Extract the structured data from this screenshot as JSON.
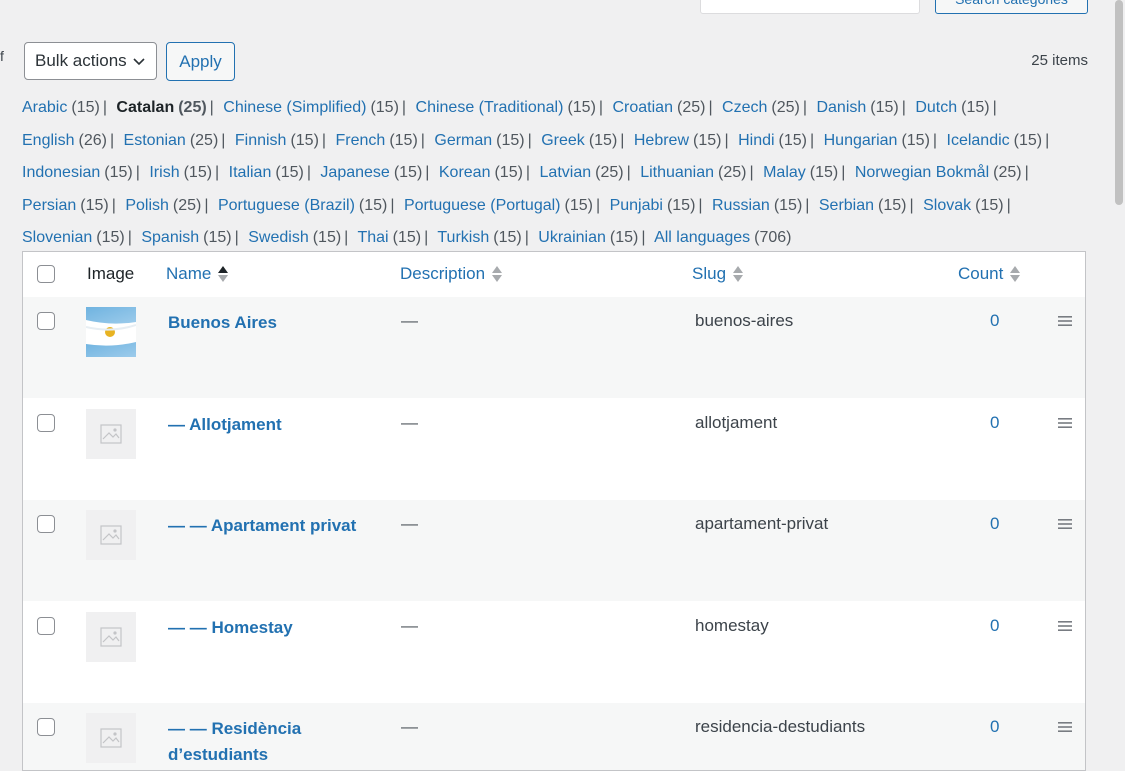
{
  "top": {
    "search_button": "Search categories",
    "truncated_label": "f"
  },
  "bulk": {
    "selected": "Bulk actions",
    "apply": "Apply"
  },
  "items_count": "25 items",
  "languages": [
    {
      "name": "Arabic",
      "count": "(15)",
      "current": false
    },
    {
      "name": "Catalan",
      "count": "(25)",
      "current": true
    },
    {
      "name": "Chinese (Simplified)",
      "count": "(15)",
      "current": false
    },
    {
      "name": "Chinese (Traditional)",
      "count": "(15)",
      "current": false
    },
    {
      "name": "Croatian",
      "count": "(25)",
      "current": false
    },
    {
      "name": "Czech",
      "count": "(25)",
      "current": false
    },
    {
      "name": "Danish",
      "count": "(15)",
      "current": false
    },
    {
      "name": "Dutch",
      "count": "(15)",
      "current": false
    },
    {
      "name": "English",
      "count": "(26)",
      "current": false
    },
    {
      "name": "Estonian",
      "count": "(25)",
      "current": false
    },
    {
      "name": "Finnish",
      "count": "(15)",
      "current": false
    },
    {
      "name": "French",
      "count": "(15)",
      "current": false
    },
    {
      "name": "German",
      "count": "(15)",
      "current": false
    },
    {
      "name": "Greek",
      "count": "(15)",
      "current": false
    },
    {
      "name": "Hebrew",
      "count": "(15)",
      "current": false
    },
    {
      "name": "Hindi",
      "count": "(15)",
      "current": false
    },
    {
      "name": "Hungarian",
      "count": "(15)",
      "current": false
    },
    {
      "name": "Icelandic",
      "count": "(15)",
      "current": false
    },
    {
      "name": "Indonesian",
      "count": "(15)",
      "current": false
    },
    {
      "name": "Irish",
      "count": "(15)",
      "current": false
    },
    {
      "name": "Italian",
      "count": "(15)",
      "current": false
    },
    {
      "name": "Japanese",
      "count": "(15)",
      "current": false
    },
    {
      "name": "Korean",
      "count": "(15)",
      "current": false
    },
    {
      "name": "Latvian",
      "count": "(25)",
      "current": false
    },
    {
      "name": "Lithuanian",
      "count": "(25)",
      "current": false
    },
    {
      "name": "Malay",
      "count": "(15)",
      "current": false
    },
    {
      "name": "Norwegian Bokmål",
      "count": "(25)",
      "current": false
    },
    {
      "name": "Persian",
      "count": "(15)",
      "current": false
    },
    {
      "name": "Polish",
      "count": "(25)",
      "current": false
    },
    {
      "name": "Portuguese (Brazil)",
      "count": "(15)",
      "current": false
    },
    {
      "name": "Portuguese (Portugal)",
      "count": "(15)",
      "current": false
    },
    {
      "name": "Punjabi",
      "count": "(15)",
      "current": false
    },
    {
      "name": "Russian",
      "count": "(15)",
      "current": false
    },
    {
      "name": "Serbian",
      "count": "(15)",
      "current": false
    },
    {
      "name": "Slovak",
      "count": "(15)",
      "current": false
    },
    {
      "name": "Slovenian",
      "count": "(15)",
      "current": false
    },
    {
      "name": "Spanish",
      "count": "(15)",
      "current": false
    },
    {
      "name": "Swedish",
      "count": "(15)",
      "current": false
    },
    {
      "name": "Thai",
      "count": "(15)",
      "current": false
    },
    {
      "name": "Turkish",
      "count": "(15)",
      "current": false
    },
    {
      "name": "Ukrainian",
      "count": "(15)",
      "current": false
    },
    {
      "name": "All languages",
      "count": "(706)",
      "current": false
    }
  ],
  "table": {
    "headers": {
      "image": "Image",
      "name": "Name",
      "description": "Description",
      "slug": "Slug",
      "count": "Count"
    },
    "rows": [
      {
        "name": "Buenos Aires",
        "description": "—",
        "slug": "buenos-aires",
        "count": "0",
        "thumb": "flag-argentina"
      },
      {
        "name": "— Allotjament",
        "description": "—",
        "slug": "allotjament",
        "count": "0",
        "thumb": "placeholder"
      },
      {
        "name": "— — Apartament privat",
        "description": "—",
        "slug": "apartament-privat",
        "count": "0",
        "thumb": "placeholder"
      },
      {
        "name": "— — Homestay",
        "description": "—",
        "slug": "homestay",
        "count": "0",
        "thumb": "placeholder"
      },
      {
        "name": "— — Residència d’estudiants",
        "description": "—",
        "slug": "residencia-destudiants",
        "count": "0",
        "thumb": "placeholder"
      }
    ]
  },
  "colors": {
    "link": "#2271b1",
    "text": "#3c434a",
    "bg": "#f0f0f1",
    "row_alt": "#f6f7f7"
  }
}
